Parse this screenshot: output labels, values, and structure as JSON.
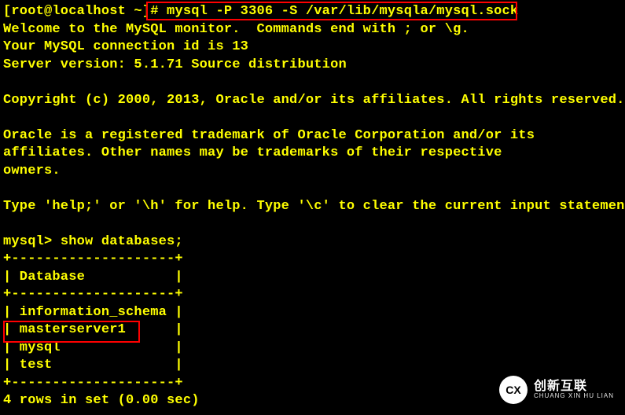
{
  "terminal": {
    "prompt_shell": "[root@localhost ~]# ",
    "command_1": "mysql -P 3306 -S /var/lib/mysqla/mysql.sock",
    "banner": [
      "Welcome to the MySQL monitor.  Commands end with ; or \\g.",
      "Your MySQL connection id is 13",
      "Server version: 5.1.71 Source distribution",
      "",
      "Copyright (c) 2000, 2013, Oracle and/or its affiliates. All rights reserved.",
      "",
      "Oracle is a registered trademark of Oracle Corporation and/or its",
      "affiliates. Other names may be trademarks of their respective",
      "owners.",
      "",
      "Type 'help;' or '\\h' for help. Type '\\c' to clear the current input statement.",
      ""
    ],
    "prompt_mysql": "mysql> ",
    "command_2": "show databases;",
    "table": {
      "border_top": "+--------------------+",
      "header": "| Database           |",
      "border_mid": "+--------------------+",
      "rows": [
        "| information_schema |",
        "| masterserver1      |",
        "| mysql              |",
        "| test               |"
      ],
      "border_bot": "+--------------------+"
    },
    "result_line": "4 rows in set (0.00 sec)"
  },
  "watermark": {
    "logo_text": "CX",
    "title": "创新互联",
    "subtitle": "CHUANG XIN HU LIAN"
  }
}
